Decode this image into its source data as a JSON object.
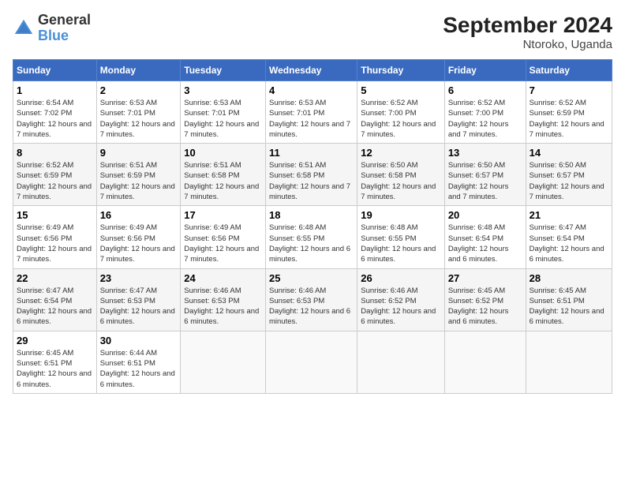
{
  "logo": {
    "general": "General",
    "blue": "Blue"
  },
  "title": "September 2024",
  "subtitle": "Ntoroko, Uganda",
  "days_of_week": [
    "Sunday",
    "Monday",
    "Tuesday",
    "Wednesday",
    "Thursday",
    "Friday",
    "Saturday"
  ],
  "weeks": [
    [
      {
        "day": "1",
        "sunrise": "6:54 AM",
        "sunset": "7:02 PM",
        "daylight": "12 hours and 7 minutes."
      },
      {
        "day": "2",
        "sunrise": "6:53 AM",
        "sunset": "7:01 PM",
        "daylight": "12 hours and 7 minutes."
      },
      {
        "day": "3",
        "sunrise": "6:53 AM",
        "sunset": "7:01 PM",
        "daylight": "12 hours and 7 minutes."
      },
      {
        "day": "4",
        "sunrise": "6:53 AM",
        "sunset": "7:01 PM",
        "daylight": "12 hours and 7 minutes."
      },
      {
        "day": "5",
        "sunrise": "6:52 AM",
        "sunset": "7:00 PM",
        "daylight": "12 hours and 7 minutes."
      },
      {
        "day": "6",
        "sunrise": "6:52 AM",
        "sunset": "7:00 PM",
        "daylight": "12 hours and 7 minutes."
      },
      {
        "day": "7",
        "sunrise": "6:52 AM",
        "sunset": "6:59 PM",
        "daylight": "12 hours and 7 minutes."
      }
    ],
    [
      {
        "day": "8",
        "sunrise": "6:52 AM",
        "sunset": "6:59 PM",
        "daylight": "12 hours and 7 minutes."
      },
      {
        "day": "9",
        "sunrise": "6:51 AM",
        "sunset": "6:59 PM",
        "daylight": "12 hours and 7 minutes."
      },
      {
        "day": "10",
        "sunrise": "6:51 AM",
        "sunset": "6:58 PM",
        "daylight": "12 hours and 7 minutes."
      },
      {
        "day": "11",
        "sunrise": "6:51 AM",
        "sunset": "6:58 PM",
        "daylight": "12 hours and 7 minutes."
      },
      {
        "day": "12",
        "sunrise": "6:50 AM",
        "sunset": "6:58 PM",
        "daylight": "12 hours and 7 minutes."
      },
      {
        "day": "13",
        "sunrise": "6:50 AM",
        "sunset": "6:57 PM",
        "daylight": "12 hours and 7 minutes."
      },
      {
        "day": "14",
        "sunrise": "6:50 AM",
        "sunset": "6:57 PM",
        "daylight": "12 hours and 7 minutes."
      }
    ],
    [
      {
        "day": "15",
        "sunrise": "6:49 AM",
        "sunset": "6:56 PM",
        "daylight": "12 hours and 7 minutes."
      },
      {
        "day": "16",
        "sunrise": "6:49 AM",
        "sunset": "6:56 PM",
        "daylight": "12 hours and 7 minutes."
      },
      {
        "day": "17",
        "sunrise": "6:49 AM",
        "sunset": "6:56 PM",
        "daylight": "12 hours and 7 minutes."
      },
      {
        "day": "18",
        "sunrise": "6:48 AM",
        "sunset": "6:55 PM",
        "daylight": "12 hours and 6 minutes."
      },
      {
        "day": "19",
        "sunrise": "6:48 AM",
        "sunset": "6:55 PM",
        "daylight": "12 hours and 6 minutes."
      },
      {
        "day": "20",
        "sunrise": "6:48 AM",
        "sunset": "6:54 PM",
        "daylight": "12 hours and 6 minutes."
      },
      {
        "day": "21",
        "sunrise": "6:47 AM",
        "sunset": "6:54 PM",
        "daylight": "12 hours and 6 minutes."
      }
    ],
    [
      {
        "day": "22",
        "sunrise": "6:47 AM",
        "sunset": "6:54 PM",
        "daylight": "12 hours and 6 minutes."
      },
      {
        "day": "23",
        "sunrise": "6:47 AM",
        "sunset": "6:53 PM",
        "daylight": "12 hours and 6 minutes."
      },
      {
        "day": "24",
        "sunrise": "6:46 AM",
        "sunset": "6:53 PM",
        "daylight": "12 hours and 6 minutes."
      },
      {
        "day": "25",
        "sunrise": "6:46 AM",
        "sunset": "6:53 PM",
        "daylight": "12 hours and 6 minutes."
      },
      {
        "day": "26",
        "sunrise": "6:46 AM",
        "sunset": "6:52 PM",
        "daylight": "12 hours and 6 minutes."
      },
      {
        "day": "27",
        "sunrise": "6:45 AM",
        "sunset": "6:52 PM",
        "daylight": "12 hours and 6 minutes."
      },
      {
        "day": "28",
        "sunrise": "6:45 AM",
        "sunset": "6:51 PM",
        "daylight": "12 hours and 6 minutes."
      }
    ],
    [
      {
        "day": "29",
        "sunrise": "6:45 AM",
        "sunset": "6:51 PM",
        "daylight": "12 hours and 6 minutes."
      },
      {
        "day": "30",
        "sunrise": "6:44 AM",
        "sunset": "6:51 PM",
        "daylight": "12 hours and 6 minutes."
      },
      null,
      null,
      null,
      null,
      null
    ]
  ]
}
